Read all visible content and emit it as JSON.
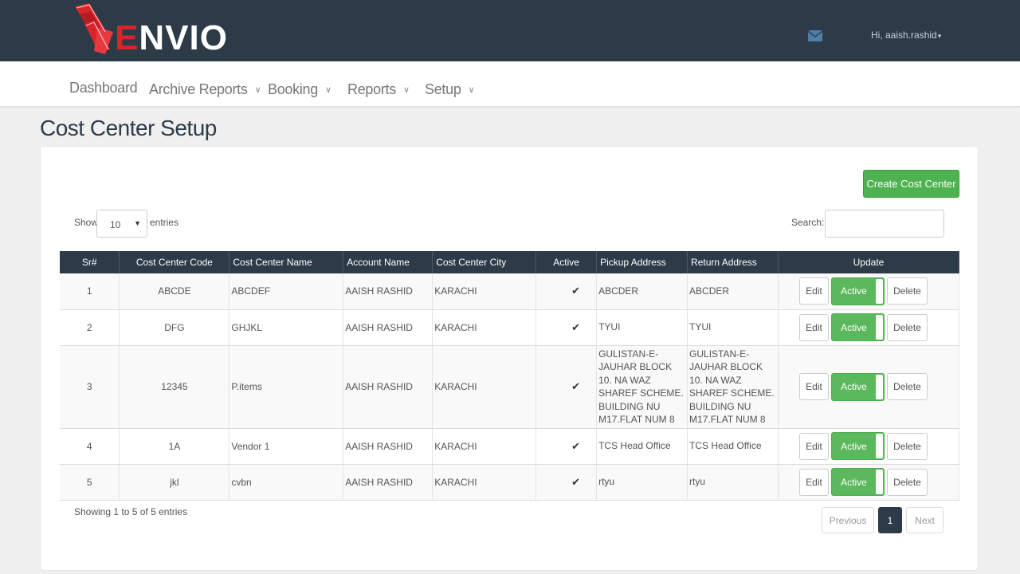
{
  "header": {
    "logo_text_e": "E",
    "logo_text_rest": "NVIO",
    "logo_icon": "envio-logo-mark",
    "mail_icon": "envelope-icon",
    "user_greeting": "Hi, aaish.rashid",
    "user_caret": "▾"
  },
  "nav": {
    "items": [
      {
        "label": "Dashboard",
        "dropdown": false
      },
      {
        "label": "Archive Reports",
        "dropdown": true
      },
      {
        "label": "Booking",
        "dropdown": true
      },
      {
        "label": "Reports",
        "dropdown": true
      },
      {
        "label": "Setup",
        "dropdown": true
      }
    ],
    "chevron": "∨"
  },
  "page": {
    "title": "Cost Center Setup"
  },
  "toolbar": {
    "create_label": "Create Cost Center",
    "show_label": "Show",
    "entries_value": "10",
    "entries_label": "entries",
    "search_label": "Search:",
    "search_value": ""
  },
  "table": {
    "columns": [
      "Sr#",
      "Cost Center Code",
      "Cost Center Name",
      "Account Name",
      "Cost Center City",
      "Active",
      "Pickup Address",
      "Return Address",
      "Update"
    ],
    "rows": [
      {
        "sr": "1",
        "code": "ABCDE",
        "name": "ABCDEF",
        "account": "AAISH RASHID",
        "city": "KARACHI",
        "active": "✔",
        "pickup": "ABCDER",
        "return": "ABCDER"
      },
      {
        "sr": "2",
        "code": "DFG",
        "name": "GHJKL",
        "account": "AAISH RASHID",
        "city": "KARACHI",
        "active": "✔",
        "pickup": "TYUI",
        "return": "TYUI"
      },
      {
        "sr": "3",
        "code": "12345",
        "name": "P.items",
        "account": "AAISH RASHID",
        "city": "KARACHI",
        "active": "✔",
        "pickup": "GULISTAN-E-JAUHAR BLOCK 10. NA WAZ SHAREF SCHEME. BUILDING NU M17.FLAT NUM 8",
        "return": "GULISTAN-E-JAUHAR BLOCK 10. NA WAZ SHAREF SCHEME. BUILDING NU M17.FLAT NUM 8"
      },
      {
        "sr": "4",
        "code": "1A",
        "name": "Vendor 1",
        "account": "AAISH RASHID",
        "city": "KARACHI",
        "active": "✔",
        "pickup": "TCS Head Office",
        "return": "TCS Head Office"
      },
      {
        "sr": "5",
        "code": "jkl",
        "name": "cvbn",
        "account": "AAISH RASHID",
        "city": "KARACHI",
        "active": "✔",
        "pickup": "rtyu",
        "return": "rtyu"
      }
    ],
    "edit_label": "Edit",
    "active_label": "Active",
    "delete_label": "Delete"
  },
  "footer": {
    "info": "Showing 1 to 5 of 5 entries",
    "prev_label": "Previous",
    "current_page": "1",
    "next_label": "Next"
  },
  "colors": {
    "header_bg": "#2d3a48",
    "brand_red": "#d9242b",
    "success_green": "#5cb85c"
  }
}
